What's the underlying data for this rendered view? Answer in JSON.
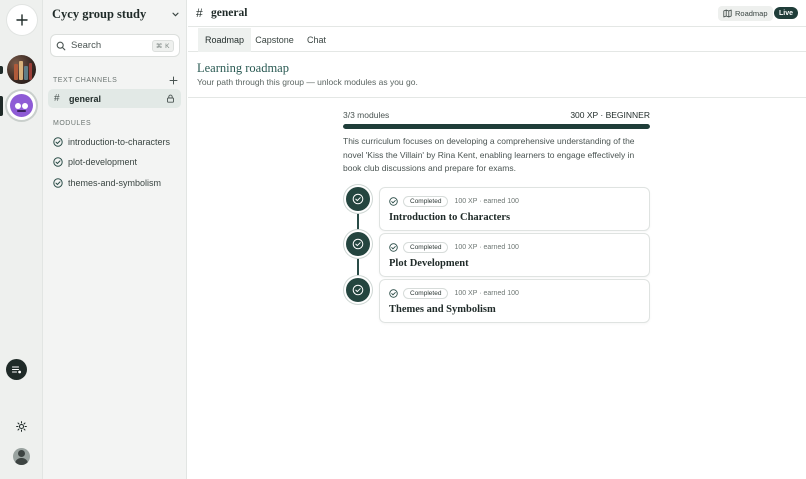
{
  "group": {
    "title": "Cycy group study"
  },
  "search": {
    "label": "Search",
    "shortcut": "⌘ K"
  },
  "sidebar": {
    "text_channels_label": "TEXT CHANNELS",
    "active_channel": "general",
    "modules_label": "MODULES",
    "modules": [
      {
        "name": "introduction-to-characters"
      },
      {
        "name": "plot-development"
      },
      {
        "name": "themes-and-symbolism"
      }
    ]
  },
  "header": {
    "channel": "general",
    "roadmap_label": "Roadmap",
    "live_label": "Live"
  },
  "tabs": [
    {
      "label": "Roadmap",
      "active": true
    },
    {
      "label": "Capstone",
      "active": false
    },
    {
      "label": "Chat",
      "active": false
    }
  ],
  "roadmap": {
    "title": "Learning roadmap",
    "subtitle": "Your path through this group — unlock modules as you go.",
    "modules_count": "3/3 modules",
    "xp_level": "300 XP · BEGINNER",
    "progress_fraction": 1.0,
    "description": "This curriculum focuses on developing a comprehensive understanding of the novel 'Kiss the Villain' by Rina Kent, enabling learners to engage effectively in book club discussions and prepare for exams.",
    "modules": [
      {
        "status": "Completed",
        "xp": "100 XP · earned 100",
        "title": "Introduction to Characters"
      },
      {
        "status": "Completed",
        "xp": "100 XP · earned 100",
        "title": "Plot Development"
      },
      {
        "status": "Completed",
        "xp": "100 XP · earned 100",
        "title": "Themes and Symbolism"
      }
    ]
  },
  "colors": {
    "accent": "#1f3d39",
    "title": "#2a5a53",
    "active_channel_bg": "#e2e9e6"
  },
  "icons": [
    "plus-icon",
    "chevron-down-icon",
    "search-icon",
    "hash-icon",
    "lock-icon",
    "check-circle-icon",
    "map-icon",
    "sun-icon",
    "list-icon"
  ]
}
